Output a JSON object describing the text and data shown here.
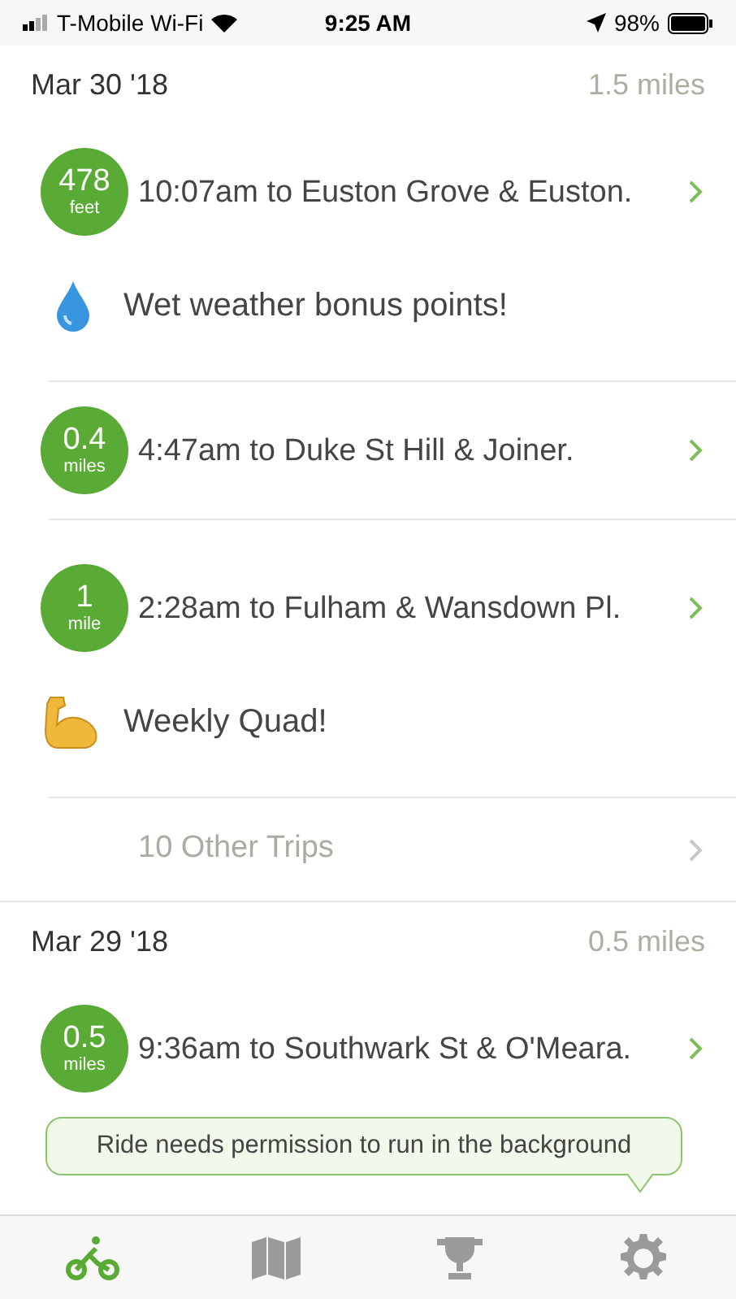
{
  "status_bar": {
    "carrier": "T-Mobile Wi-Fi",
    "time": "9:25 AM",
    "battery": "98%"
  },
  "sections": [
    {
      "date": "Mar 30 '18",
      "distance": "1.5 miles",
      "groups": [
        {
          "trip": {
            "amount": "478",
            "unit": "feet",
            "title": "10:07am to Euston Grove & Euston."
          },
          "bonus": {
            "kind": "wet",
            "text": "Wet weather bonus points!"
          }
        },
        {
          "trip": {
            "amount": "0.4",
            "unit": "miles",
            "title": "4:47am to Duke St Hill & Joiner."
          }
        },
        {
          "trip": {
            "amount": "1",
            "unit": "mile",
            "title": "2:28am to Fulham & Wansdown Pl."
          },
          "bonus": {
            "kind": "quad",
            "text": "Weekly Quad!"
          }
        }
      ],
      "more": "10 Other Trips"
    },
    {
      "date": "Mar 29 '18",
      "distance": "0.5 miles",
      "groups": [
        {
          "trip": {
            "amount": "0.5",
            "unit": "miles",
            "title": "9:36am to Southwark St & O'Meara."
          }
        }
      ]
    }
  ],
  "tooltip": "Ride needs permission to run in the background",
  "tabs": [
    {
      "kind": "ride",
      "selected": true
    },
    {
      "kind": "map",
      "selected": false
    },
    {
      "kind": "trophy",
      "selected": false
    },
    {
      "kind": "settings",
      "selected": false
    }
  ]
}
